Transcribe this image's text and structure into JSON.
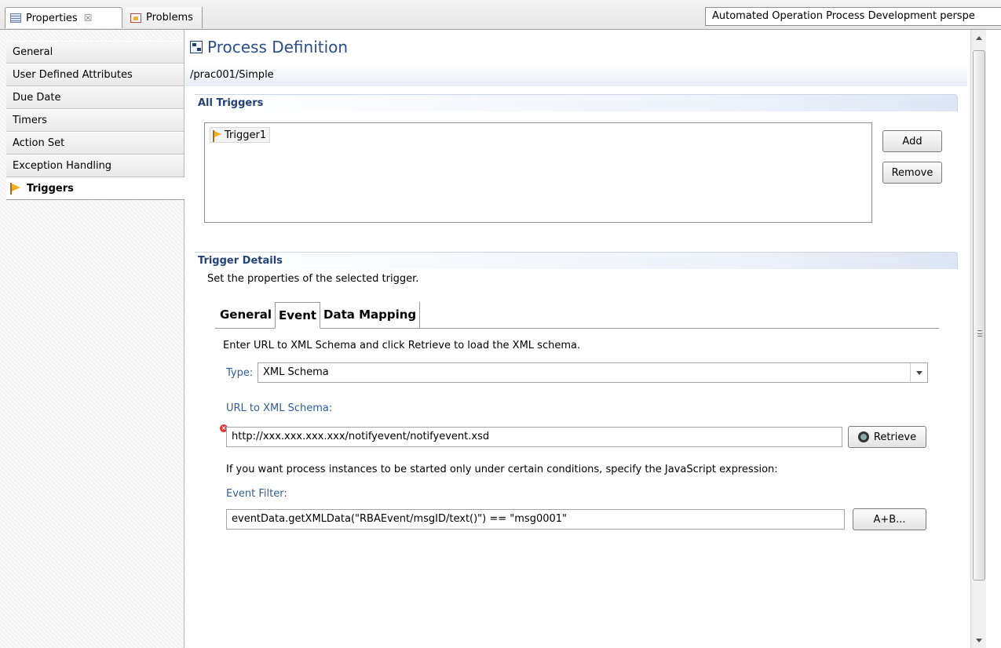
{
  "top_tabs": {
    "properties": "Properties",
    "properties_close": "☒",
    "problems": "Problems",
    "perspective": "Automated Operation Process Development perspe"
  },
  "sidebar": {
    "items": [
      {
        "label": "General"
      },
      {
        "label": "User Defined Attributes"
      },
      {
        "label": "Due Date"
      },
      {
        "label": "Timers"
      },
      {
        "label": "Action Set"
      },
      {
        "label": "Exception Handling"
      },
      {
        "label": "Triggers",
        "selected": true,
        "icon": "flag-icon"
      }
    ]
  },
  "header": {
    "title": "Process Definition",
    "path": "/prac001/Simple"
  },
  "all_triggers": {
    "heading": "All Triggers",
    "items": [
      "Trigger1"
    ],
    "add_label": "Add",
    "remove_label": "Remove"
  },
  "trigger_details": {
    "heading": "Trigger Details",
    "description": "Set the properties of the selected trigger.",
    "tabs": [
      {
        "label": "General"
      },
      {
        "label": "Event",
        "active": true
      },
      {
        "label": "Data Mapping"
      }
    ],
    "instruction": "Enter URL to XML Schema and click Retrieve to load the XML schema.",
    "type_label": "Type:",
    "type_value": "XML Schema",
    "url_label": "URL to XML Schema:",
    "url_value": "http://xxx.xxx.xxx.xxx/notifyevent/notifyevent.xsd",
    "retrieve_label": "Retrieve",
    "condition_text": "If you want process instances to be started only under certain conditions, specify the JavaScript expression:",
    "filter_label": "Event Filter:",
    "filter_value": "eventData.getXMLData(\"RBAEvent/msgID/text()\")  == \"msg0001\"",
    "expression_button": "A+B..."
  },
  "colors": {
    "title": "#2a4e8c",
    "section_heading": "#24427a",
    "field_label": "#2e5d9e",
    "error": "#dd3333"
  }
}
